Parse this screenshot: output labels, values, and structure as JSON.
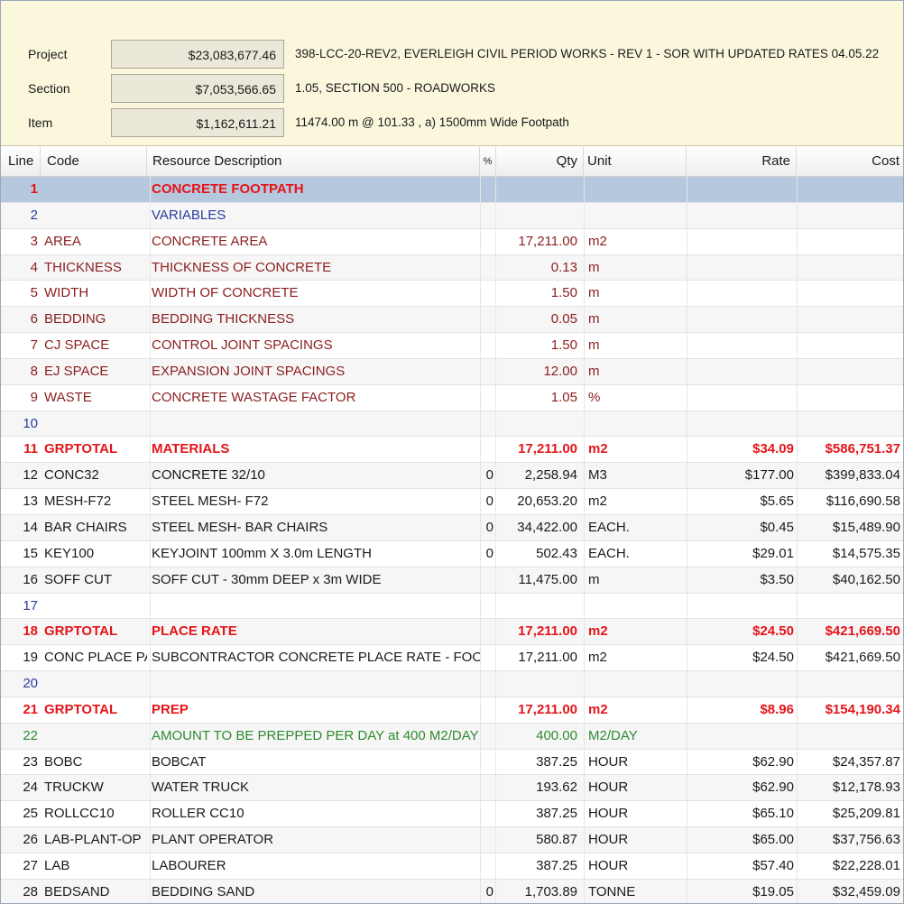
{
  "header": {
    "project": {
      "label": "Project",
      "amount": "$23,083,677.46",
      "desc": "398-LCC-20-REV2, EVERLEIGH CIVIL PERIOD WORKS - REV 1 - SOR WITH UPDATED RATES 04.05.22"
    },
    "section": {
      "label": "Section",
      "amount": "$7,053,566.65",
      "desc": "1.05, SECTION 500 - ROADWORKS"
    },
    "item": {
      "label": "Item",
      "amount": "$1,162,611.21",
      "desc": "11474.00 m @ 101.33 , a) 1500mm Wide Footpath"
    }
  },
  "columns": {
    "line": "Line",
    "code": "Code",
    "desc": "Resource Description",
    "pct": "%",
    "qty": "Qty",
    "unit": "Unit",
    "rate": "Rate",
    "cost": "Cost"
  },
  "rows": [
    {
      "line": "1",
      "code": "",
      "desc": "CONCRETE FOOTPATH",
      "pct": "",
      "qty": "",
      "unit": "",
      "rate": "",
      "cost": "",
      "style": "red",
      "selected": true
    },
    {
      "line": "2",
      "code": "",
      "desc": "VARIABLES",
      "pct": "",
      "qty": "",
      "unit": "",
      "rate": "",
      "cost": "",
      "style": "blue"
    },
    {
      "line": "3",
      "code": "AREA",
      "desc": "CONCRETE AREA",
      "pct": "",
      "qty": "17,211.00",
      "unit": "m2",
      "rate": "",
      "cost": "",
      "style": "var"
    },
    {
      "line": "4",
      "code": "THICKNESS",
      "desc": "THICKNESS OF CONCRETE",
      "pct": "",
      "qty": "0.13",
      "unit": "m",
      "rate": "",
      "cost": "",
      "style": "var"
    },
    {
      "line": "5",
      "code": "WIDTH",
      "desc": "WIDTH OF CONCRETE",
      "pct": "",
      "qty": "1.50",
      "unit": "m",
      "rate": "",
      "cost": "",
      "style": "var"
    },
    {
      "line": "6",
      "code": "BEDDING",
      "desc": "BEDDING THICKNESS",
      "pct": "",
      "qty": "0.05",
      "unit": "m",
      "rate": "",
      "cost": "",
      "style": "var"
    },
    {
      "line": "7",
      "code": "CJ SPACE",
      "desc": "CONTROL JOINT SPACINGS",
      "pct": "",
      "qty": "1.50",
      "unit": "m",
      "rate": "",
      "cost": "",
      "style": "var"
    },
    {
      "line": "8",
      "code": "EJ SPACE",
      "desc": "EXPANSION JOINT SPACINGS",
      "pct": "",
      "qty": "12.00",
      "unit": "m",
      "rate": "",
      "cost": "",
      "style": "var"
    },
    {
      "line": "9",
      "code": "WASTE",
      "desc": "CONCRETE WASTAGE FACTOR",
      "pct": "",
      "qty": "1.05",
      "unit": "%",
      "rate": "",
      "cost": "",
      "style": "var"
    },
    {
      "line": "10",
      "code": "",
      "desc": "",
      "pct": "",
      "qty": "",
      "unit": "",
      "rate": "",
      "cost": "",
      "style": "blue"
    },
    {
      "line": "11",
      "code": "GRPTOTAL",
      "desc": "MATERIALS",
      "pct": "",
      "qty": "17,211.00",
      "unit": "m2",
      "rate": "$34.09",
      "cost": "$586,751.37",
      "style": "red"
    },
    {
      "line": "12",
      "code": "CONC32",
      "desc": "CONCRETE 32/10",
      "pct": "0",
      "qty": "2,258.94",
      "unit": "M3",
      "rate": "$177.00",
      "cost": "$399,833.04",
      "style": "normal"
    },
    {
      "line": "13",
      "code": "MESH-F72",
      "desc": "STEEL MESH- F72",
      "pct": "0",
      "qty": "20,653.20",
      "unit": "m2",
      "rate": "$5.65",
      "cost": "$116,690.58",
      "style": "normal"
    },
    {
      "line": "14",
      "code": "BAR CHAIRS",
      "desc": "STEEL MESH- BAR CHAIRS",
      "pct": "0",
      "qty": "34,422.00",
      "unit": "EACH.",
      "rate": "$0.45",
      "cost": "$15,489.90",
      "style": "normal"
    },
    {
      "line": "15",
      "code": "KEY100",
      "desc": "KEYJOINT 100mm X 3.0m LENGTH",
      "pct": "0",
      "qty": "502.43",
      "unit": "EACH.",
      "rate": "$29.01",
      "cost": "$14,575.35",
      "style": "normal"
    },
    {
      "line": "16",
      "code": "SOFF CUT",
      "desc": "SOFF CUT - 30mm DEEP x 3m WIDE",
      "pct": "",
      "qty": "11,475.00",
      "unit": "m",
      "rate": "$3.50",
      "cost": "$40,162.50",
      "style": "normal"
    },
    {
      "line": "17",
      "code": "",
      "desc": "",
      "pct": "",
      "qty": "",
      "unit": "",
      "rate": "",
      "cost": "",
      "style": "blue"
    },
    {
      "line": "18",
      "code": "GRPTOTAL",
      "desc": "PLACE RATE",
      "pct": "",
      "qty": "17,211.00",
      "unit": "m2",
      "rate": "$24.50",
      "cost": "$421,669.50",
      "style": "red"
    },
    {
      "line": "19",
      "code": "CONC PLACE PA",
      "desc": "SUBCONTRACTOR CONCRETE PLACE RATE - FOOTPATH",
      "pct": "",
      "qty": "17,211.00",
      "unit": "m2",
      "rate": "$24.50",
      "cost": "$421,669.50",
      "style": "normal"
    },
    {
      "line": "20",
      "code": "",
      "desc": "",
      "pct": "",
      "qty": "",
      "unit": "",
      "rate": "",
      "cost": "",
      "style": "blue"
    },
    {
      "line": "21",
      "code": "GRPTOTAL",
      "desc": "PREP",
      "pct": "",
      "qty": "17,211.00",
      "unit": "m2",
      "rate": "$8.96",
      "cost": "$154,190.34",
      "style": "red"
    },
    {
      "line": "22",
      "code": "",
      "desc": "AMOUNT TO BE PREPPED PER DAY at 400 M2/DAY",
      "pct": "",
      "qty": "400.00",
      "unit": "M2/DAY",
      "rate": "",
      "cost": "",
      "style": "green"
    },
    {
      "line": "23",
      "code": "BOBC",
      "desc": "BOBCAT",
      "pct": "",
      "qty": "387.25",
      "unit": "HOUR",
      "rate": "$62.90",
      "cost": "$24,357.87",
      "style": "normal"
    },
    {
      "line": "24",
      "code": "TRUCKW",
      "desc": "WATER TRUCK",
      "pct": "",
      "qty": "193.62",
      "unit": "HOUR",
      "rate": "$62.90",
      "cost": "$12,178.93",
      "style": "normal"
    },
    {
      "line": "25",
      "code": "ROLLCC10",
      "desc": "ROLLER CC10",
      "pct": "",
      "qty": "387.25",
      "unit": "HOUR",
      "rate": "$65.10",
      "cost": "$25,209.81",
      "style": "normal"
    },
    {
      "line": "26",
      "code": "LAB-PLANT-OP",
      "desc": "PLANT OPERATOR",
      "pct": "",
      "qty": "580.87",
      "unit": "HOUR",
      "rate": "$65.00",
      "cost": "$37,756.63",
      "style": "normal"
    },
    {
      "line": "27",
      "code": "LAB",
      "desc": "LABOURER",
      "pct": "",
      "qty": "387.25",
      "unit": "HOUR",
      "rate": "$57.40",
      "cost": "$22,228.01",
      "style": "normal"
    },
    {
      "line": "28",
      "code": "BEDSAND",
      "desc": "BEDDING SAND",
      "pct": "0",
      "qty": "1,703.89",
      "unit": "TONNE",
      "rate": "$19.05",
      "cost": "$32,459.09",
      "style": "normal"
    }
  ]
}
